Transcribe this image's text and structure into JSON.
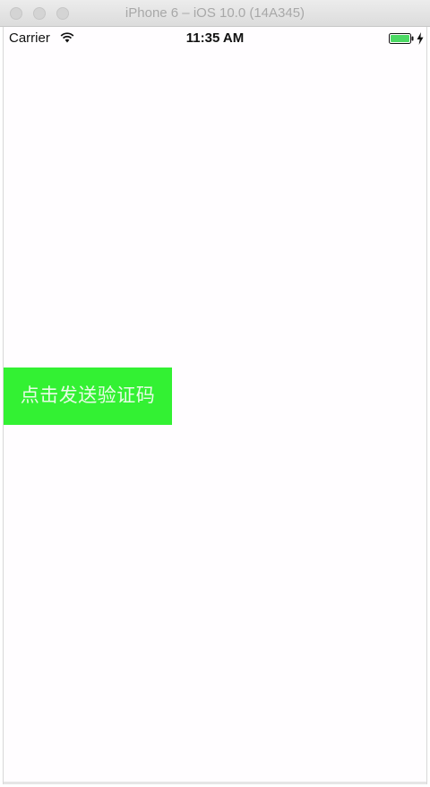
{
  "window": {
    "title": "iPhone 6 – iOS 10.0 (14A345)"
  },
  "status_bar": {
    "carrier": "Carrier",
    "time": "11:35 AM",
    "wifi_icon": "wifi-icon",
    "battery_icon": "battery-icon",
    "battery_level": 1.0,
    "charging_icon": "bolt-icon"
  },
  "main": {
    "send_code_label": "点击发送验证码",
    "button_color": "#33f133"
  }
}
